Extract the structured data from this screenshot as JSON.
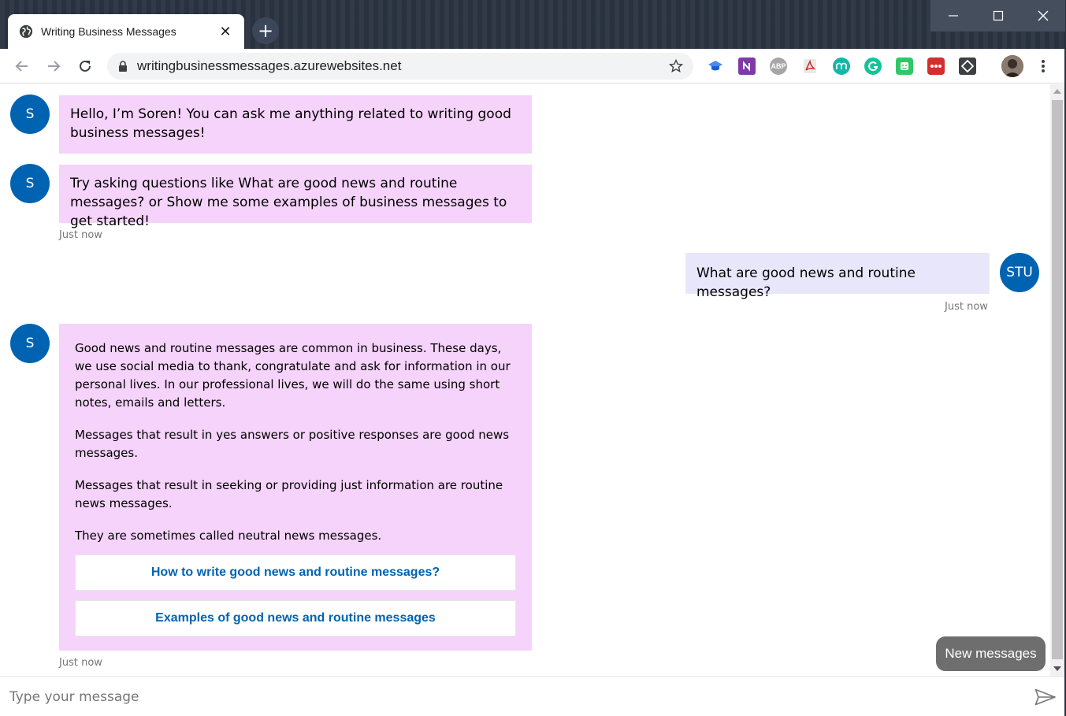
{
  "browser": {
    "tab_title": "Writing Business Messages",
    "tab_close": "✕",
    "new_tab": "+",
    "url": "writingbusinessmessages.azurewebsites.net",
    "extensions": [
      "ABP"
    ]
  },
  "bot": {
    "avatar_initial": "S",
    "messages": [
      "Hello, I’m Soren! You can ask me anything related to writing good business messages!",
      "Try asking questions like What are good news and routine messages? or Show me some examples of business messages to get started!"
    ],
    "timestamp_1": "Just now"
  },
  "user": {
    "avatar_initial": "STU",
    "message": "What are good news and routine messages?",
    "timestamp": "Just now"
  },
  "card": {
    "paragraphs": [
      "Good news and routine messages are common in business. These days, we use social media to thank, congratulate and ask for information in our personal lives. In our professional lives, we will do the same using short notes, emails and letters.",
      "Messages that result in yes answers or positive responses are good news messages.",
      "Messages that result in seeking or providing just information are routine news messages.",
      "They are sometimes called neutral news messages."
    ],
    "buttons": [
      "How to write good news and routine messages?",
      "Examples of good news and routine messages"
    ],
    "timestamp": "Just now"
  },
  "new_messages_label": "New messages",
  "input": {
    "placeholder": "Type your message",
    "value": ""
  },
  "colors": {
    "bot_bubble": "#f5d3fa",
    "user_bubble": "#e8e6fa",
    "avatar": "#0063b1",
    "button_text": "#0063b1"
  }
}
